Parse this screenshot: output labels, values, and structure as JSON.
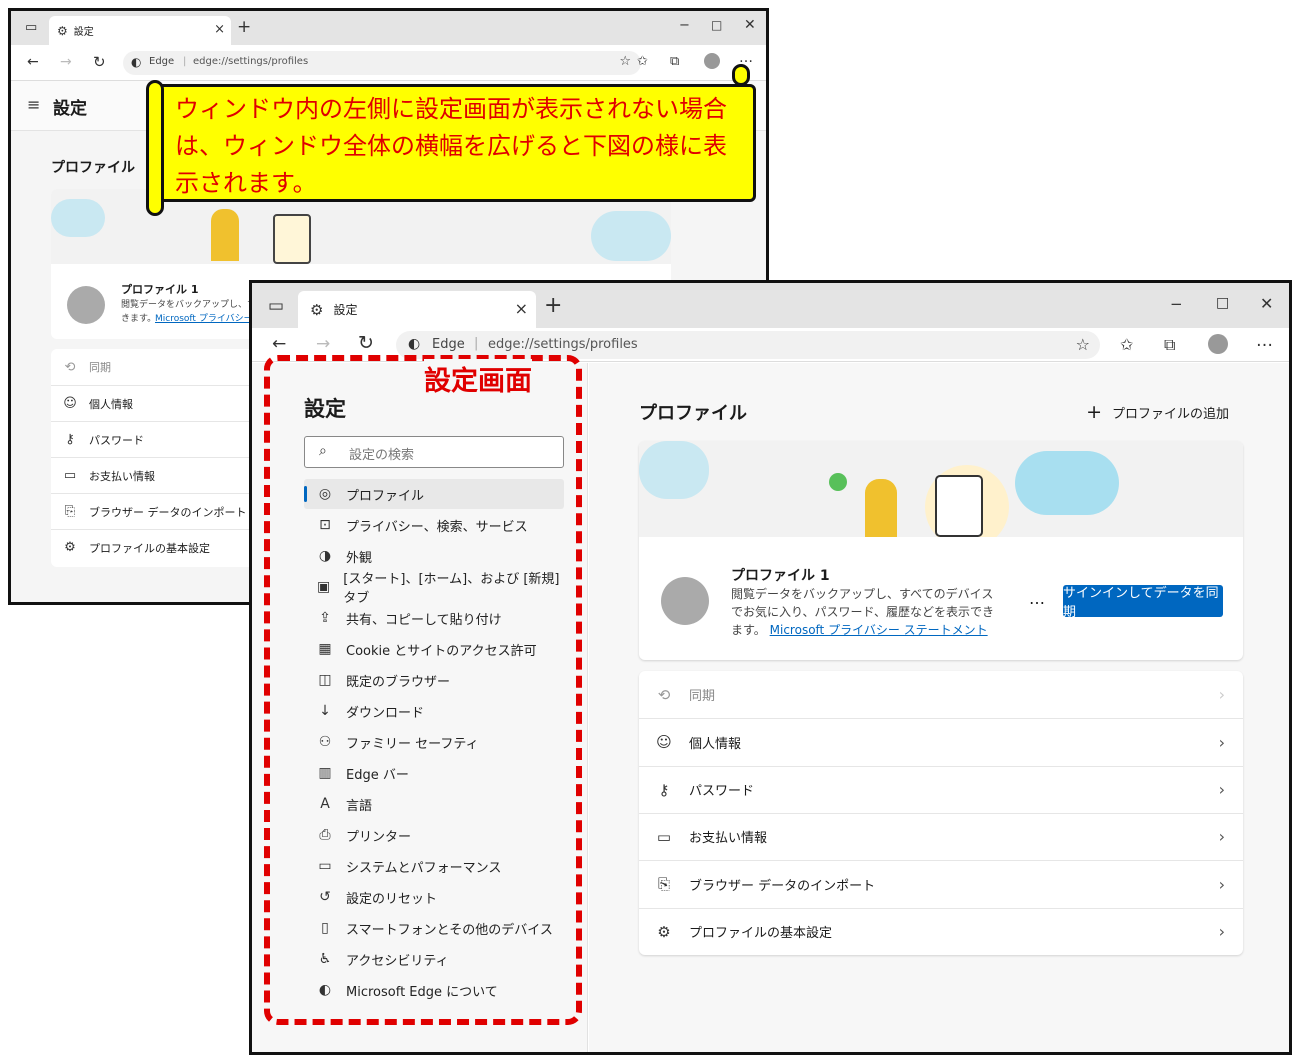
{
  "back_window": {
    "tab_title": "設定",
    "address_brand": "Edge",
    "address_url": "edge://settings/profiles",
    "menu_title": "設定",
    "section_title": "プロファイル",
    "profile_name": "プロファイル 1",
    "profile_desc": "閲覧データをバックアップし、すべ",
    "profile_desc2": "きます。",
    "profile_link": "Microsoft プライバシー",
    "rows": [
      {
        "label": "同期",
        "icon": "sync-icon"
      },
      {
        "label": "個人情報",
        "icon": "person-icon"
      },
      {
        "label": "パスワード",
        "icon": "key-icon"
      },
      {
        "label": "お支払い情報",
        "icon": "card-icon"
      },
      {
        "label": "ブラウザー データのインポート",
        "icon": "import-icon"
      },
      {
        "label": "プロファイルの基本設定",
        "icon": "profile-settings-icon"
      }
    ]
  },
  "callout": {
    "text": "ウィンドウ内の左側に設定画面が表示されない場合は、ウィンドウ全体の横幅を広げると下図の様に表示されます。",
    "bg_color": "#ffff00",
    "text_color": "#e00000"
  },
  "front_window": {
    "tab_title": "設定",
    "address_brand": "Edge",
    "address_url": "edge://settings/profiles",
    "annotation_label": "設定画面",
    "sidebar_title": "設定",
    "search_placeholder": "設定の検索",
    "nav_items": [
      {
        "label": "プロファイル",
        "icon": "profile-icon",
        "active": true
      },
      {
        "label": "プライバシー、検索、サービス",
        "icon": "lock-icon"
      },
      {
        "label": "外観",
        "icon": "appearance-icon"
      },
      {
        "label": "[スタート]、[ホーム]、および [新規] タブ",
        "icon": "home-tabs-icon"
      },
      {
        "label": "共有、コピーして貼り付け",
        "icon": "share-icon"
      },
      {
        "label": "Cookie とサイトのアクセス許可",
        "icon": "cookie-icon"
      },
      {
        "label": "既定のブラウザー",
        "icon": "default-browser-icon"
      },
      {
        "label": "ダウンロード",
        "icon": "download-icon"
      },
      {
        "label": "ファミリー セーフティ",
        "icon": "family-icon"
      },
      {
        "label": "Edge バー",
        "icon": "edge-bar-icon"
      },
      {
        "label": "言語",
        "icon": "language-icon"
      },
      {
        "label": "プリンター",
        "icon": "printer-icon"
      },
      {
        "label": "システムとパフォーマンス",
        "icon": "system-icon"
      },
      {
        "label": "設定のリセット",
        "icon": "reset-icon"
      },
      {
        "label": "スマートフォンとその他のデバイス",
        "icon": "phone-icon"
      },
      {
        "label": "アクセシビリティ",
        "icon": "accessibility-icon"
      },
      {
        "label": "Microsoft Edge について",
        "icon": "edge-logo-icon"
      }
    ],
    "content_title": "プロファイル",
    "add_profile": "プロファイルの追加",
    "profile_name": "プロファイル 1",
    "profile_desc": "閲覧データをバックアップし、すべてのデバイスでお気に入り、パスワード、履歴などを表示できます。",
    "profile_link": "Microsoft プライバシー ステートメント",
    "more": "…",
    "sync_button": "サインインしてデータを同期",
    "rows": [
      {
        "label": "同期",
        "icon": "sync-icon",
        "disabled": true
      },
      {
        "label": "個人情報",
        "icon": "person-icon"
      },
      {
        "label": "パスワード",
        "icon": "key-icon"
      },
      {
        "label": "お支払い情報",
        "icon": "card-icon"
      },
      {
        "label": "ブラウザー データのインポート",
        "icon": "import-icon"
      },
      {
        "label": "プロファイルの基本設定",
        "icon": "profile-settings-icon"
      }
    ]
  },
  "colors": {
    "accent": "#0067c0",
    "annotation_red": "#e00000",
    "callout_yellow": "#ffff00"
  }
}
